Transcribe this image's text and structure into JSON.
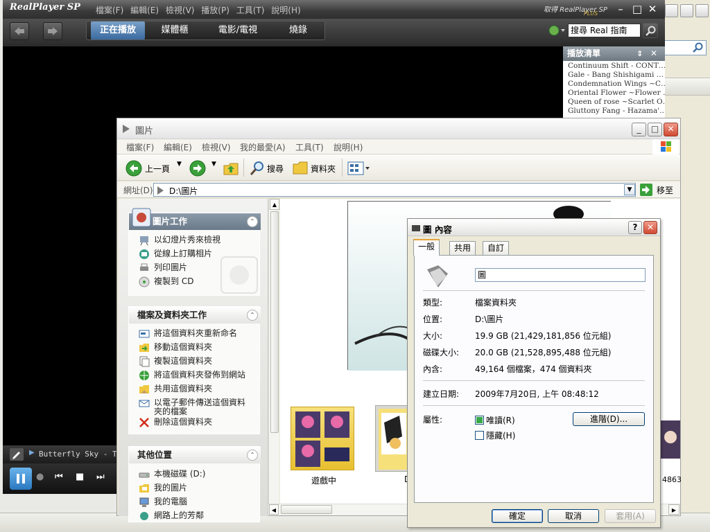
{
  "realplayer": {
    "logo": "RealPlayer SP",
    "menu": [
      "檔案(F)",
      "編輯(E)",
      "檢視(V)",
      "播放(P)",
      "工具(T)",
      "說明(H)"
    ],
    "promo": "取得 RealPlayer SP",
    "promo_sub": "PLUS",
    "tabs": [
      "正在播放",
      "媒體櫃",
      "電影/電視",
      "燒錄"
    ],
    "search_placeholder": "搜尋 Real 指南",
    "playlist_title": "播放清單",
    "playlist": [
      "Continuum Shift - CONT…",
      "Gale - Bang Shishigami …",
      "Condemnation Wings ~C…",
      "Oriental Flower ~Flower …",
      "Queen of rose ~Scarlet O…",
      "Gluttony Fang - Hazama'…"
    ],
    "now_playing": "Butterfly Sky - Tor"
  },
  "explorer": {
    "title": "圖片",
    "menu": [
      "檔案(F)",
      "編輯(E)",
      "檢視(V)",
      "我的最愛(A)",
      "工具(T)",
      "說明(H)"
    ],
    "toolbar": {
      "back": "上一頁",
      "search": "搜尋",
      "folders": "資料夾"
    },
    "address_label": "網址(D)",
    "address_value": "D:\\圖片",
    "go_label": "移至",
    "panels": {
      "picture_tasks": {
        "title": "圖片工作",
        "items": [
          "以幻燈片秀來檢視",
          "從線上訂購相片",
          "列印圖片",
          "複製到 CD"
        ]
      },
      "file_tasks": {
        "title": "檔案及資料夾工作",
        "items": [
          "將這個資料夾重新命名",
          "移動這個資料夾",
          "複製這個資料夾",
          "將這個資料夾發佈到網站",
          "共用這個資料夾",
          "以電子郵件傳送這個資料夾的檔案",
          "刪除這個資料夾"
        ]
      },
      "other_places": {
        "title": "其他位置",
        "items": [
          "本機磁碟 (D:)",
          "我的圖片",
          "我的電腦",
          "網路上的芳鄰"
        ]
      }
    },
    "folders": [
      {
        "name": "遊戲中"
      },
      {
        "name": "D"
      }
    ],
    "right_edge_label": "4863"
  },
  "dialog": {
    "title": "圖 內容",
    "tabs": [
      "一般",
      "共用",
      "自訂"
    ],
    "name_value": "圖",
    "rows": [
      {
        "label": "類型:",
        "value": "檔案資料夾"
      },
      {
        "label": "位置:",
        "value": "D:\\圖片"
      },
      {
        "label": "大小:",
        "value": "19.9 GB (21,429,181,856 位元組)"
      },
      {
        "label": "磁碟大小:",
        "value": "20.0 GB (21,528,895,488 位元組)"
      },
      {
        "label": "內含:",
        "value": "49,164 個檔案，474 個資料夾"
      }
    ],
    "created_label": "建立日期:",
    "created_value": "2009年7月20日, 上午 08:48:12",
    "attributes_label": "屬性:",
    "attr_readonly": "唯讀(R)",
    "attr_hidden": "隱藏(H)",
    "advanced_button": "進階(D)...",
    "ok_button": "確定",
    "cancel_button": "取消",
    "apply_button": "套用(A)"
  }
}
